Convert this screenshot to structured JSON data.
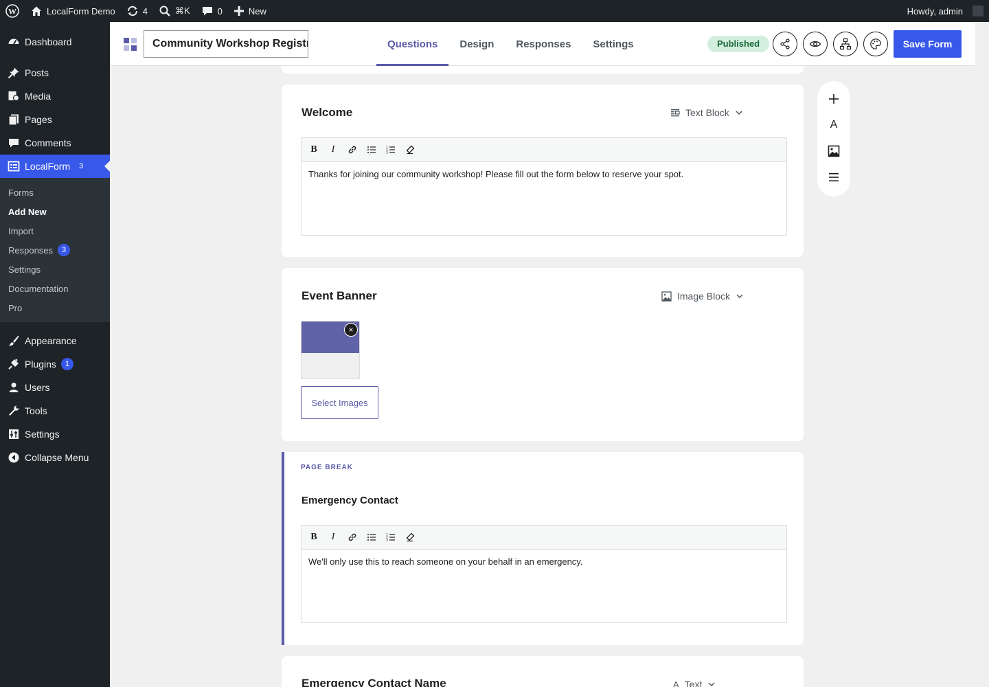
{
  "adminbar": {
    "site_name": "LocalForm Demo",
    "updates_count": "4",
    "command_shortcut": "⌘K",
    "comments_count": "0",
    "new_label": "New",
    "greeting": "Howdy, admin"
  },
  "sidebar": {
    "items": [
      {
        "label": "Dashboard",
        "icon": "dashboard-icon"
      },
      {
        "label": "Posts",
        "icon": "pin-icon"
      },
      {
        "label": "Media",
        "icon": "media-icon"
      },
      {
        "label": "Pages",
        "icon": "pages-icon"
      },
      {
        "label": "Comments",
        "icon": "comment-icon"
      },
      {
        "label": "LocalForm",
        "icon": "form-icon",
        "badge": "3"
      }
    ],
    "submenu": [
      {
        "label": "Forms"
      },
      {
        "label": "Add New"
      },
      {
        "label": "Import"
      },
      {
        "label": "Responses",
        "badge": "3"
      },
      {
        "label": "Settings"
      },
      {
        "label": "Documentation"
      },
      {
        "label": "Pro"
      }
    ],
    "items_bottom": [
      {
        "label": "Appearance",
        "icon": "brush-icon"
      },
      {
        "label": "Plugins",
        "icon": "plugin-icon",
        "badge": "1"
      },
      {
        "label": "Users",
        "icon": "user-icon"
      },
      {
        "label": "Tools",
        "icon": "wrench-icon"
      },
      {
        "label": "Settings",
        "icon": "settings-icon"
      },
      {
        "label": "Collapse Menu",
        "icon": "collapse-icon"
      }
    ]
  },
  "editor": {
    "form_title": "Community Workshop Registr",
    "tabs": [
      "Questions",
      "Design",
      "Responses",
      "Settings"
    ],
    "status": "Published",
    "save_label": "Save Form"
  },
  "blocks": {
    "welcome": {
      "title": "Welcome",
      "type": "Text Block",
      "content": "Thanks for joining our community workshop! Please fill out the form below to reserve your spot."
    },
    "banner": {
      "title": "Event Banner",
      "type": "Image Block",
      "remove_symbol": "×",
      "select_label": "Select Images"
    },
    "pagebreak": {
      "label": "PAGE BREAK",
      "title": "Emergency Contact",
      "content": "We'll only use this to reach someone on your behalf in an emergency."
    },
    "next": {
      "title": "Emergency Contact Name",
      "type": "Text"
    }
  },
  "toolbar_buttons": [
    "B",
    "I"
  ],
  "float_tools": {
    "text_glyph": "A"
  },
  "colors": {
    "accent": "#5a5ba8",
    "primary": "#3858e9",
    "admin_dark": "#1d2327"
  }
}
